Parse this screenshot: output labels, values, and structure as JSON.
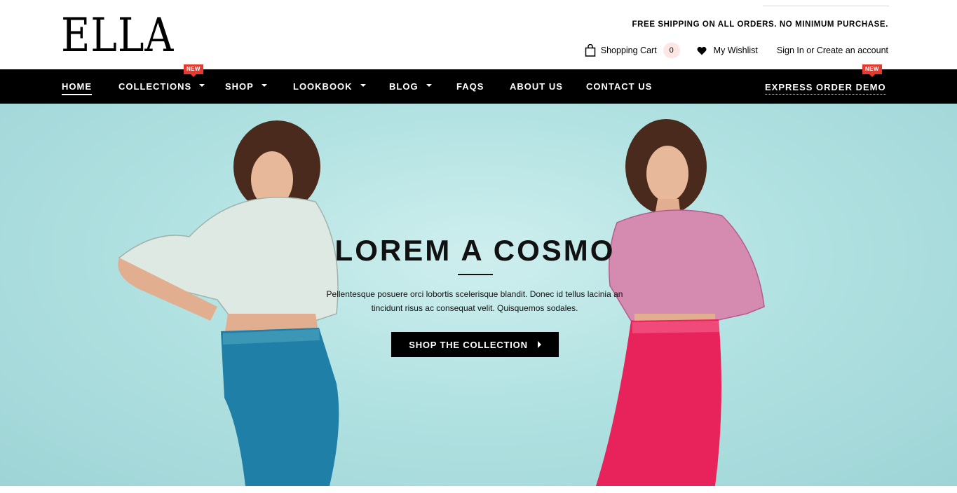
{
  "header": {
    "logo": "ELLA",
    "promo": "FREE SHIPPING ON ALL ORDERS. NO MINIMUM PURCHASE.",
    "cart_label": "Shopping Cart",
    "cart_count": "0",
    "wishlist_label": "My Wishlist",
    "signin_label": "Sign In or Create an account"
  },
  "nav": {
    "items": [
      {
        "label": "HOME"
      },
      {
        "label": "COLLECTIONS",
        "badge": "NEW"
      },
      {
        "label": "SHOP"
      },
      {
        "label": "LOOKBOOK"
      },
      {
        "label": "BLOG"
      },
      {
        "label": "FAQS"
      },
      {
        "label": "ABOUT US"
      },
      {
        "label": "CONTACT US"
      }
    ],
    "express": {
      "label": "EXPRESS ORDER DEMO",
      "badge": "NEW"
    }
  },
  "hero": {
    "title": "LOREM A COSMO",
    "text": "Pellentesque posuere orci lobortis scelerisque blandit. Donec id tellus lacinia an tincidunt risus ac consequat velit. Quisquemos sodales.",
    "button": "SHOP THE COLLECTION"
  },
  "colors": {
    "badge": "#e7392d",
    "hero_bg": "#b2e2e2",
    "nav_bg": "#000000",
    "legging_left": "#1f7fa6",
    "legging_right": "#e8235c"
  }
}
